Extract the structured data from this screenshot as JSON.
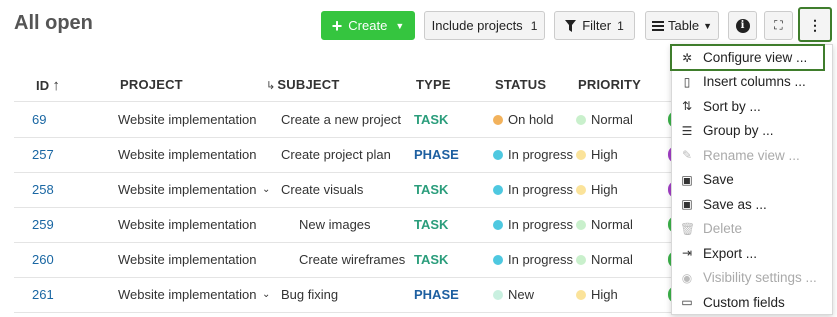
{
  "header": {
    "title": "All open"
  },
  "toolbar": {
    "create_label": "Create",
    "include_label": "Include projects",
    "include_count": "1",
    "filter_label": "Filter",
    "filter_count": "1",
    "table_label": "Table",
    "info_glyph": "i",
    "fullscreen_glyph": "⛶",
    "more_glyph": "⋮"
  },
  "columns": {
    "id": "ID",
    "project": "PROJECT",
    "subject": "SUBJECT",
    "type": "TYPE",
    "status": "STATUS",
    "priority": "PRIORITY"
  },
  "rows": [
    {
      "id": "69",
      "project": "Website implementation",
      "subject": "Create a new project",
      "type": "TASK",
      "type_color": "#2a9d7b",
      "status": "On hold",
      "status_color": "#f2b25c",
      "priority": "Normal",
      "priority_color": "#c9f0cc",
      "expandable": false,
      "indent": 0,
      "avatar_color": "#3cb34a"
    },
    {
      "id": "257",
      "project": "Website implementation",
      "subject": "Create project plan",
      "type": "PHASE",
      "type_color": "#1d5fa0",
      "status": "In progress",
      "status_color": "#4ec8e0",
      "priority": "High",
      "priority_color": "#fbe39a",
      "expandable": false,
      "indent": 0,
      "avatar_color": "#a33fc7"
    },
    {
      "id": "258",
      "project": "Website implementation",
      "subject": "Create visuals",
      "type": "TASK",
      "type_color": "#2a9d7b",
      "status": "In progress",
      "status_color": "#4ec8e0",
      "priority": "High",
      "priority_color": "#fbe39a",
      "expandable": true,
      "indent": 0,
      "avatar_color": "#a33fc7"
    },
    {
      "id": "259",
      "project": "Website implementation",
      "subject": "New images",
      "type": "TASK",
      "type_color": "#2a9d7b",
      "status": "In progress",
      "status_color": "#4ec8e0",
      "priority": "Normal",
      "priority_color": "#c9f0cc",
      "expandable": false,
      "indent": 1,
      "avatar_color": "#3cb34a"
    },
    {
      "id": "260",
      "project": "Website implementation",
      "subject": "Create wireframes",
      "type": "TASK",
      "type_color": "#2a9d7b",
      "status": "In progress",
      "status_color": "#4ec8e0",
      "priority": "Normal",
      "priority_color": "#c9f0cc",
      "expandable": false,
      "indent": 1,
      "avatar_color": "#3cb34a"
    },
    {
      "id": "261",
      "project": "Website implementation",
      "subject": "Bug fixing",
      "type": "PHASE",
      "type_color": "#1d5fa0",
      "status": "New",
      "status_color": "#c9f0e0",
      "priority": "High",
      "priority_color": "#fbe39a",
      "expandable": true,
      "indent": 0,
      "avatar_color": "#3cb34a"
    }
  ],
  "menu": {
    "items": [
      {
        "label": "Configure view ...",
        "icon": "gear-icon",
        "glyph": "✲",
        "disabled": false,
        "highlighted": true
      },
      {
        "label": "Insert columns ...",
        "icon": "columns-icon",
        "glyph": "▯",
        "disabled": false,
        "highlighted": false
      },
      {
        "label": "Sort by ...",
        "icon": "sort-icon",
        "glyph": "⇅",
        "disabled": false,
        "highlighted": false
      },
      {
        "label": "Group by ...",
        "icon": "group-icon",
        "glyph": "☰",
        "disabled": false,
        "highlighted": false
      },
      {
        "label": "Rename view ...",
        "icon": "pencil-icon",
        "glyph": "✎",
        "disabled": true,
        "highlighted": false
      },
      {
        "label": "Save",
        "icon": "save-icon",
        "glyph": "▣",
        "disabled": false,
        "highlighted": false
      },
      {
        "label": "Save as ...",
        "icon": "save-as-icon",
        "glyph": "▣",
        "disabled": false,
        "highlighted": false
      },
      {
        "label": "Delete",
        "icon": "trash-icon",
        "glyph": "🗑",
        "disabled": true,
        "highlighted": false
      },
      {
        "label": "Export ...",
        "icon": "export-icon",
        "glyph": "⇥",
        "disabled": false,
        "highlighted": false
      },
      {
        "label": "Visibility settings ...",
        "icon": "eye-icon",
        "glyph": "◉",
        "disabled": true,
        "highlighted": false
      },
      {
        "label": "Custom fields",
        "icon": "custom-fields-icon",
        "glyph": "▭",
        "disabled": false,
        "highlighted": false
      }
    ]
  }
}
